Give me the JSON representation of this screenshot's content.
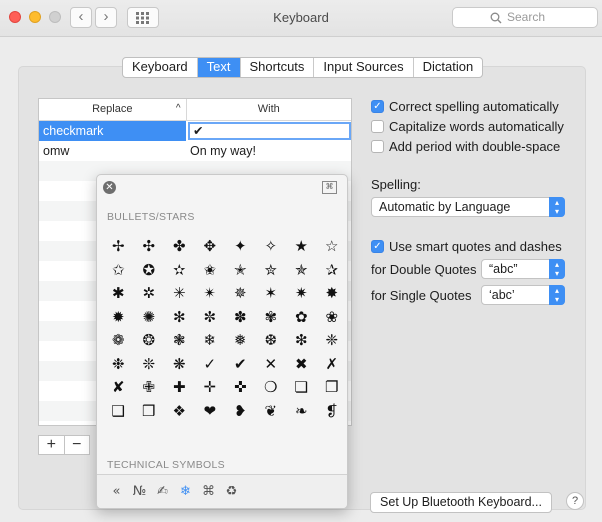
{
  "window": {
    "title": "Keyboard",
    "search_placeholder": "Search",
    "nav_back": "‹",
    "nav_forward": "›",
    "grid_icon": "grid-icon"
  },
  "tabs": [
    "Keyboard",
    "Text",
    "Shortcuts",
    "Input Sources",
    "Dictation"
  ],
  "active_tab": "Text",
  "table": {
    "col_replace": "Replace",
    "col_with": "With",
    "sort_indicator": "^",
    "rows": [
      {
        "replace": "checkmark",
        "with": "✔"
      },
      {
        "replace": "omw",
        "with": "On my way!"
      }
    ]
  },
  "add_label": "+",
  "remove_label": "−",
  "char_viewer": {
    "section1": "BULLETS/STARS",
    "section2": "TECHNICAL SYMBOLS",
    "glyphs": [
      "✢",
      "✣",
      "✤",
      "✥",
      "✦",
      "✧",
      "★",
      "☆",
      "✩",
      "✪",
      "✫",
      "✬",
      "✭",
      "✮",
      "✯",
      "✰",
      "✱",
      "✲",
      "✳",
      "✴",
      "✵",
      "✶",
      "✷",
      "✸",
      "✹",
      "✺",
      "✻",
      "✼",
      "✽",
      "✾",
      "✿",
      "❀",
      "❁",
      "❂",
      "❃",
      "❄",
      "❅",
      "❆",
      "❇",
      "❈",
      "❉",
      "❊",
      "❋",
      "✓",
      "✔",
      "✕",
      "✖",
      "✗",
      "✘",
      "✙",
      "✚",
      "✛",
      "✜",
      "❍",
      "❏",
      "❐",
      "❑",
      "❒",
      "❖",
      "❤",
      "❥",
      "❦",
      "❧",
      "❡"
    ],
    "footer_icons": [
      "«",
      "№",
      "✍",
      "❄",
      "⌘",
      "♻"
    ]
  },
  "options": {
    "correct_spelling": {
      "label": "Correct spelling automatically",
      "checked": true
    },
    "capitalize": {
      "label": "Capitalize words automatically",
      "checked": false
    },
    "period": {
      "label": "Add period with double-space",
      "checked": false
    },
    "spelling_label": "Spelling:",
    "spelling_value": "Automatic by Language",
    "smart_quotes": {
      "label": "Use smart quotes and dashes",
      "checked": true
    },
    "double_quotes_label": "for Double Quotes",
    "double_quotes_value": "“abc”",
    "single_quotes_label": "for Single Quotes",
    "single_quotes_value": "‘abc’"
  },
  "bluetooth_button": "Set Up Bluetooth Keyboard...",
  "help_label": "?",
  "colors": {
    "accent": "#3e8ff4",
    "close": "#fe5f57",
    "minimize": "#febc2e",
    "zoom": "#c8c8c8"
  }
}
